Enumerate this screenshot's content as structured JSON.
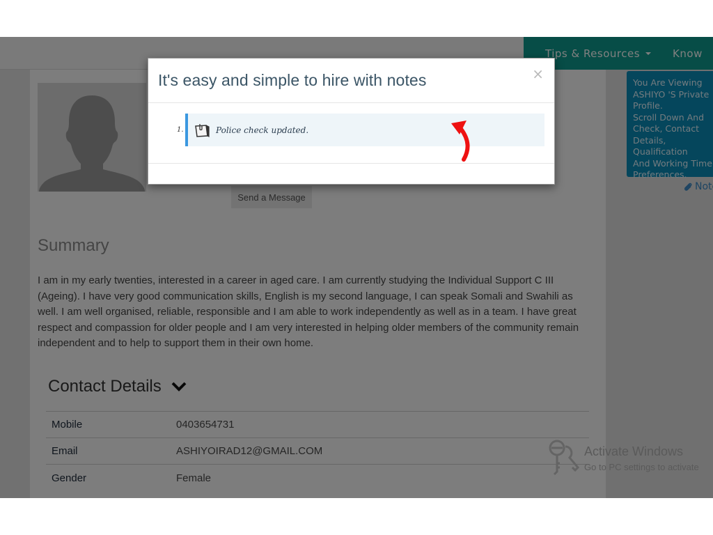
{
  "topnav": {
    "items": [
      {
        "label": "Tips & Resources",
        "has_dropdown": true
      },
      {
        "label": "Know"
      }
    ],
    "color": "#0f9a8e"
  },
  "profile": {
    "send_message_label": "Send a Message",
    "summary_title": "Summary",
    "summary_text": "I am in my early twenties, interested in a career in aged care. I am currently studying the Individual Support C III (Ageing). I have very good communication skills, English is my second language, I can speak Somali and Swahili as well. I am well organised, reliable, responsible and I am able to work independently as well as in a team. I have great respect and compassion for older people and I am very interested in helping older members of the community remain independent and to help to support them in their own home.",
    "contact_title": "Contact Details",
    "contact_rows": [
      {
        "label": "Mobile",
        "value": "0403654731"
      },
      {
        "label": "Email",
        "value": "ASHIYOIRAD12@GMAIL.COM"
      },
      {
        "label": "Gender",
        "value": "Female"
      }
    ]
  },
  "sidebar": {
    "info_text": "You Are Viewing\nASHIYO 'S Private\nProfile.\nScroll Down And\nCheck, Contact\nDetails, Qualification\nAnd Working Time\nPreferences.",
    "notes_link": "Notes",
    "info_color": "#0a8db8"
  },
  "modal": {
    "title": "It's easy and simple to hire with notes",
    "close_symbol": "×",
    "notes": [
      {
        "number": "1.",
        "text": "Police check updated."
      }
    ],
    "accent_color": "#3b98e0"
  },
  "windows_watermark": {
    "title": "Activate Windows",
    "subtitle": "Go to PC settings to activate"
  },
  "annotation": {
    "arrow_color": "#ee1111"
  }
}
